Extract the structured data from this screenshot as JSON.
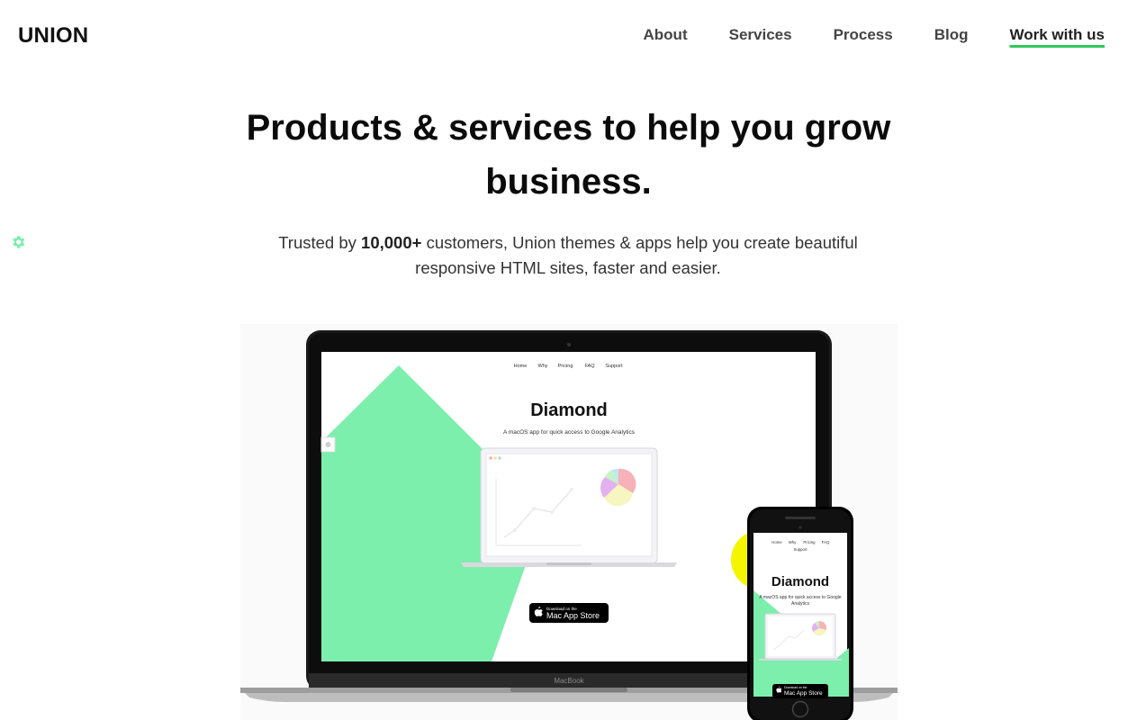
{
  "brand": {
    "logo": "UNION"
  },
  "nav": {
    "items": [
      {
        "label": "About"
      },
      {
        "label": "Services"
      },
      {
        "label": "Process"
      },
      {
        "label": "Blog"
      }
    ],
    "cta": "Work with us"
  },
  "hero": {
    "title_line1": "Products & services to help you grow",
    "title_line2": "business.",
    "sub_pre": "Trusted by ",
    "sub_bold": "10,000+",
    "sub_post": " customers, Union themes & apps help you create beautiful",
    "sub_line2": "responsive HTML sites, faster and easier."
  },
  "mockup": {
    "laptop_nav": [
      "Home",
      "Why",
      "Pricing",
      "FAQ",
      "Support"
    ],
    "laptop_title": "Diamond",
    "laptop_tagline": "A macOS app for quick access to Google Analytics",
    "store_small": "Download on the",
    "store_big": "Mac App Store",
    "laptop_brand": "MacBook",
    "phone_nav_row1": [
      "Home",
      "Why",
      "Pricing",
      "FAQ"
    ],
    "phone_nav_row2": "Support",
    "phone_title": "Diamond",
    "phone_tagline_1": "A macOS app for quick access to Google",
    "phone_tagline_2": "Analytics",
    "colors": {
      "accent_green": "#7cefac",
      "yellow": "#f5f500",
      "underline": "#2ec95c"
    }
  },
  "icons": {
    "settings": "gear-icon"
  }
}
